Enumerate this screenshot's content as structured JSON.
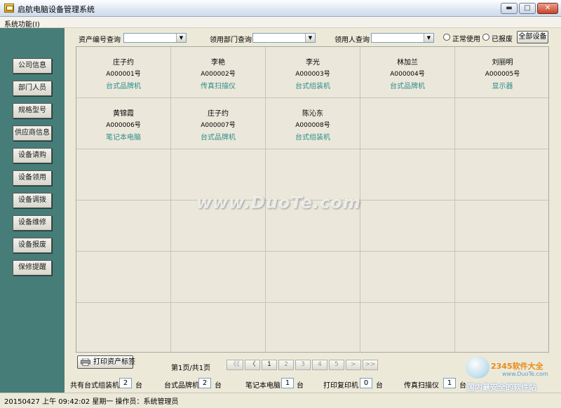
{
  "window": {
    "title": "启航电脑设备管理系统",
    "minimize": "▬",
    "maximize": "□",
    "close": "✕"
  },
  "menu": {
    "system": "系统功能(I)"
  },
  "sidebar": {
    "items": [
      {
        "label": "公司信息"
      },
      {
        "label": "部门人员"
      },
      {
        "label": "规格型号"
      },
      {
        "label": "供应商信息"
      },
      {
        "label": "设备请购"
      },
      {
        "label": "设备领用"
      },
      {
        "label": "设备调拨"
      },
      {
        "label": "设备维修"
      },
      {
        "label": "设备报废"
      },
      {
        "label": "保修提醒"
      }
    ]
  },
  "filters": {
    "asset_code_label": "资产编号查询",
    "dept_label": "领用部门查询",
    "person_label": "领用人查询",
    "radio_normal": "正常使用",
    "radio_scrapped": "已报废",
    "all_button": "全部设备"
  },
  "assets": [
    {
      "name": "庄子约",
      "code": "A000001号",
      "type": "台式品牌机"
    },
    {
      "name": "李艳",
      "code": "A000002号",
      "type": "传真扫描仪"
    },
    {
      "name": "李光",
      "code": "A000003号",
      "type": "台式组装机"
    },
    {
      "name": "林加兰",
      "code": "A000004号",
      "type": "台式品牌机"
    },
    {
      "name": "刘丽明",
      "code": "A000005号",
      "type": "显示器"
    },
    {
      "name": "黄锦霞",
      "code": "A000006号",
      "type": "笔记本电脑"
    },
    {
      "name": "庄子约",
      "code": "A000007号",
      "type": "台式品牌机"
    },
    {
      "name": "陈沁东",
      "code": "A000008号",
      "type": "台式组装机"
    }
  ],
  "pagination": {
    "print_button": "打印资产标签",
    "page_info": "第1页/共1页",
    "buttons": [
      "《《",
      "〈",
      "1",
      "2",
      "3",
      "4",
      "5",
      ">",
      ">>"
    ]
  },
  "stats": {
    "assembled_label": "共有台式组装机",
    "assembled_value": "2",
    "brand_label": "台式品牌机",
    "brand_value": "2",
    "laptop_label": "笔记本电脑",
    "laptop_value": "1",
    "printer_label": "打印复印机",
    "printer_value": "0",
    "fax_label": "传真扫描仪",
    "fax_value": "1",
    "unit": "台"
  },
  "status": {
    "text": "20150427  上午   09:42:02  星期一   操作员：系统管理员"
  },
  "watermark": {
    "text": "www.DuoTe.com",
    "logo_line1": "2345软件大全",
    "logo_line2": "www.DuoTe.com",
    "logo_line3": "国内最安全的软件站"
  },
  "colors": {
    "sidebar": "#477d78",
    "asset_type": "#2f8c8a",
    "workspace": "#ece9d8"
  }
}
